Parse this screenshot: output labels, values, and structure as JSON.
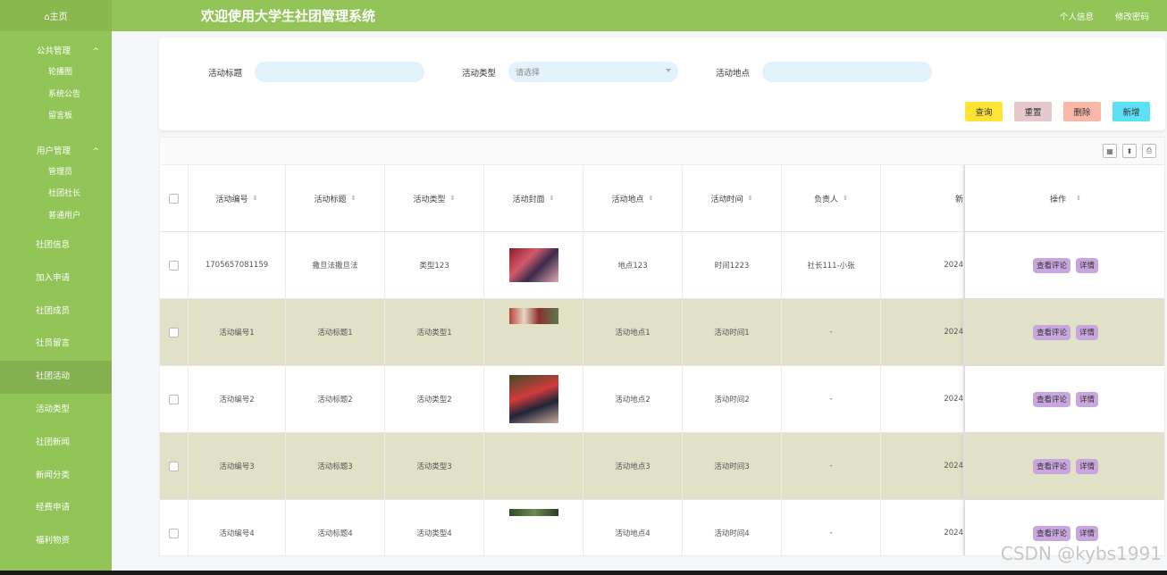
{
  "header": {
    "title": "欢迎使用大学生社团管理系统",
    "profile": "个人信息",
    "password": "修改密码"
  },
  "sidebar": {
    "home": "⌂主页",
    "groups": [
      {
        "label": "公共管理",
        "items": [
          "轮播图",
          "系统公告",
          "留言板"
        ]
      },
      {
        "label": "用户管理",
        "items": [
          "管理员",
          "社团社长",
          "普通用户"
        ]
      }
    ],
    "items": [
      "社团信息",
      "加入申请",
      "社团成员",
      "社员留言",
      "社团活动",
      "活动类型",
      "社团新闻",
      "新闻分类",
      "经费申请",
      "福利物资"
    ],
    "active": "社团活动"
  },
  "search": {
    "title_label": "活动标题",
    "type_label": "活动类型",
    "type_placeholder": "请选择",
    "place_label": "活动地点",
    "buttons": {
      "query": "查询",
      "reset": "重置",
      "delete": "删除",
      "add": "新增"
    }
  },
  "table": {
    "columns": [
      "活动编号",
      "活动标题",
      "活动类型",
      "活动封面",
      "活动地点",
      "活动时间",
      "负责人",
      "新",
      "操作"
    ],
    "rows": [
      {
        "id": "1705657081159",
        "title": "撒旦法撒旦法",
        "type": "类型123",
        "place": "地点123",
        "time": "时间1223",
        "owner": "社长111-小张",
        "date": "2024"
      },
      {
        "id": "活动编号1",
        "title": "活动标题1",
        "type": "活动类型1",
        "place": "活动地点1",
        "time": "活动时间1",
        "owner": "-",
        "date": "2024"
      },
      {
        "id": "活动编号2",
        "title": "活动标题2",
        "type": "活动类型2",
        "place": "活动地点2",
        "time": "活动时间2",
        "owner": "-",
        "date": "2024"
      },
      {
        "id": "活动编号3",
        "title": "活动标题3",
        "type": "活动类型3",
        "place": "活动地点3",
        "time": "活动时间3",
        "owner": "-",
        "date": "2024"
      },
      {
        "id": "活动编号4",
        "title": "活动标题4",
        "type": "活动类型4",
        "place": "活动地点4",
        "time": "活动时间4",
        "owner": "-",
        "date": "2024"
      }
    ],
    "ops": {
      "comments": "查看评论",
      "detail": "详情"
    }
  },
  "watermark": "CSDN @kybs1991"
}
